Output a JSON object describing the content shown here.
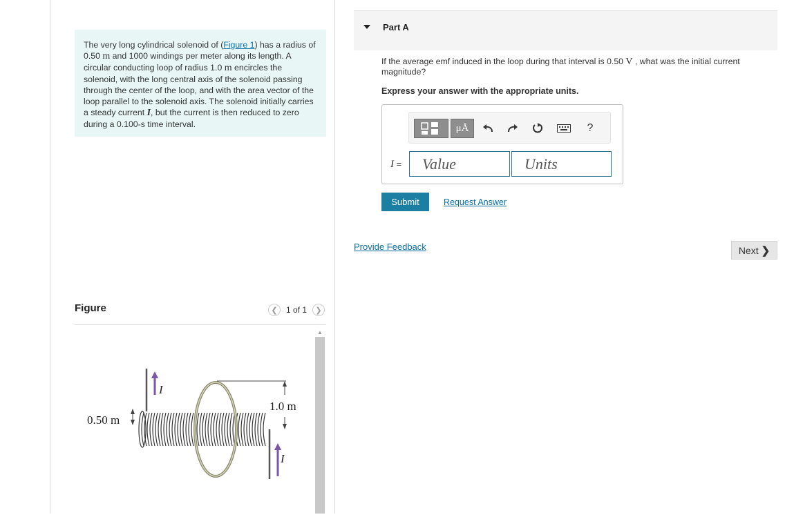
{
  "problem": {
    "t1": "The very long cylindrical solenoid of (",
    "link": "Figure 1",
    "t2": ") has a radius of 0.50 ",
    "u1": "m",
    "t3": " and 1000 windings per meter along its length. A circular conducting loop of radius 1.0 ",
    "u2": "m",
    "t4": " encircles the solenoid, with the long central axis of the solenoid passing through the center of the loop, and with the area vector of the loop parallel to the solenoid axis. The solenoid initially carries a steady current ",
    "sym": "I",
    "t5": ", but the current is then reduced to zero during a 0.100-s time interval."
  },
  "figure": {
    "title": "Figure",
    "pager": "1 of 1",
    "prev_icon": "chevron-left-icon",
    "next_icon": "chevron-right-icon",
    "label_solenoid_radius": "0.50 m",
    "label_loop_radius": "1.0 m",
    "label_current_top": "I",
    "label_current_bottom": "I"
  },
  "part": {
    "title": "Part A",
    "q1": "If the average emf induced in the loop during that interval is 0.50 ",
    "q_unit": "V",
    "q2": " , what was the initial current magnitude?",
    "instruction": "Express your answer with the appropriate units."
  },
  "toolbar": {
    "templates_icon": "templates-icon",
    "units_button": "μÅ",
    "undo_icon": "undo-icon",
    "redo_icon": "redo-icon",
    "reset_icon": "reset-icon",
    "keyboard_icon": "keyboard-icon",
    "help_label": "?"
  },
  "answer": {
    "eq_var": "I",
    "eq_sign": " =",
    "value_placeholder": "Value",
    "units_placeholder": "Units"
  },
  "buttons": {
    "submit": "Submit",
    "request_answer": "Request Answer",
    "provide_feedback": "Provide Feedback",
    "next": "Next"
  },
  "colors": {
    "accent": "#1b7fa3",
    "link": "#0b6fa4",
    "problem_bg": "#e8f6f6",
    "current_arrow": "#7a57a8"
  }
}
